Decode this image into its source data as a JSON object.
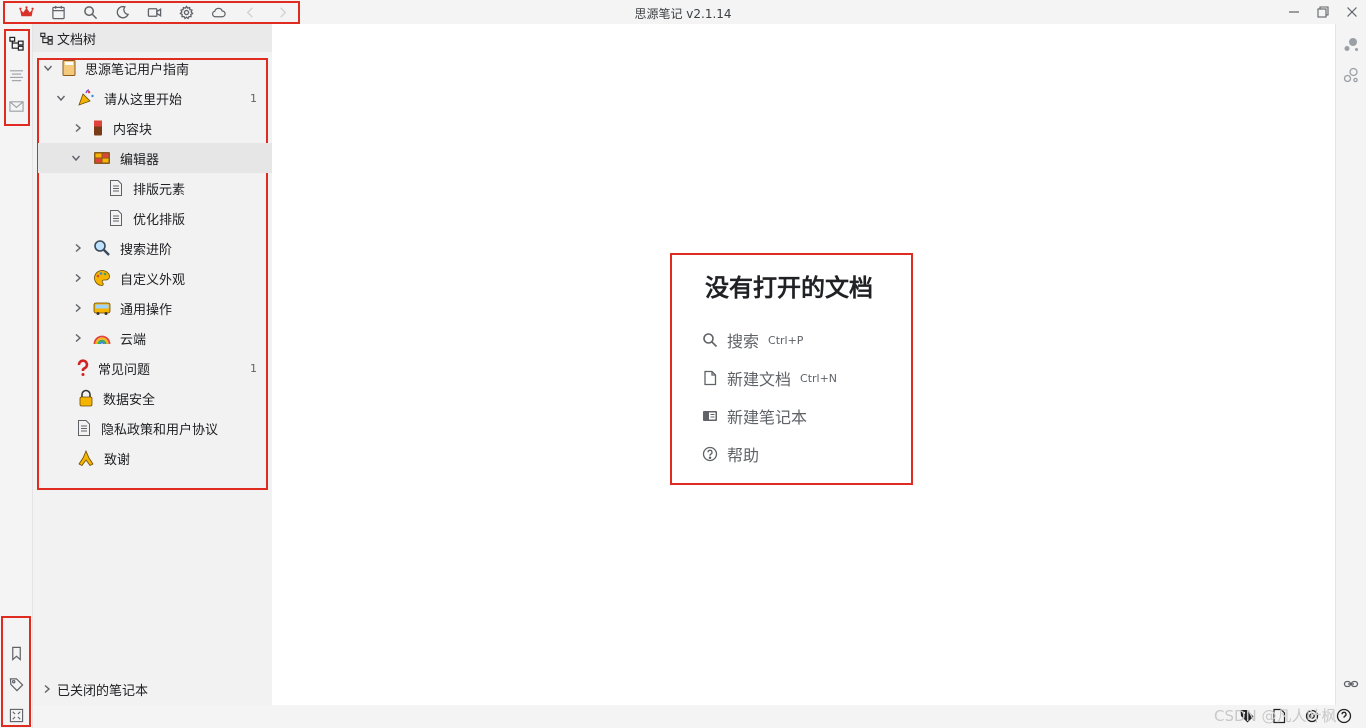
{
  "window": {
    "title": "思源笔记 v2.1.14"
  },
  "toolbar": {
    "icons": [
      "crown-icon",
      "calendar-icon",
      "search-icon",
      "moon-icon",
      "video-icon",
      "gear-icon",
      "cloud-icon",
      "back-icon",
      "forward-icon"
    ]
  },
  "left_dock": {
    "icons": [
      "file-tree-icon",
      "outline-icon",
      "inbox-icon",
      "bookmark-icon",
      "tag-icon",
      "graph-icon"
    ]
  },
  "file_tree": {
    "header": "文档树",
    "notebook": "思源笔记用户指南",
    "items": [
      {
        "label": "请从这里开始",
        "count": "1"
      },
      {
        "label": "内容块"
      },
      {
        "label": "编辑器"
      },
      {
        "label": "排版元素"
      },
      {
        "label": "优化排版"
      },
      {
        "label": "搜索进阶"
      },
      {
        "label": "自定义外观"
      },
      {
        "label": "通用操作"
      },
      {
        "label": "云端"
      },
      {
        "label": "常见问题",
        "count": "1"
      },
      {
        "label": "数据安全"
      },
      {
        "label": "隐私政策和用户协议"
      },
      {
        "label": "致谢"
      }
    ],
    "closed_notebooks": "已关闭的笔记本"
  },
  "empty_state": {
    "title": "没有打开的文档",
    "actions": [
      {
        "label": "搜索",
        "shortcut": "Ctrl+P"
      },
      {
        "label": "新建文档",
        "shortcut": "Ctrl+N"
      },
      {
        "label": "新建笔记本",
        "shortcut": ""
      },
      {
        "label": "帮助",
        "shortcut": ""
      }
    ]
  },
  "status": {
    "watermark": "CSDN @凡人叶枫"
  },
  "colors": {
    "annotation": "#e02b20",
    "crown": "#d9322a"
  }
}
